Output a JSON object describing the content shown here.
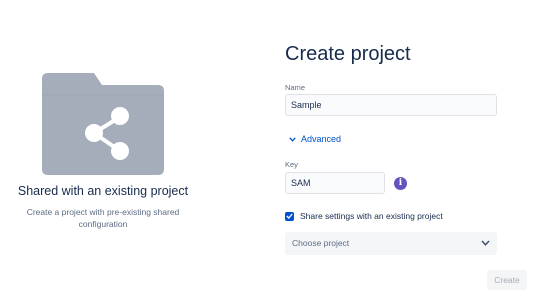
{
  "template": {
    "title": "Shared with an existing project",
    "description": "Create a project with pre-existing shared configuration",
    "illustration_icon": "share-icon"
  },
  "form": {
    "title": "Create project",
    "name_label": "Name",
    "name_value": "Sample",
    "advanced_label": "Advanced",
    "key_label": "Key",
    "key_value": "SAM",
    "info_glyph": "i",
    "share_checkbox_label": "Share settings with an existing project",
    "share_checkbox_checked": true,
    "choose_project_placeholder": "Choose project",
    "create_label": "Create"
  },
  "colors": {
    "accent": "#0052cc",
    "info": "#6554c0",
    "folder": "#a5adba",
    "disabled_text": "#a5adba"
  }
}
